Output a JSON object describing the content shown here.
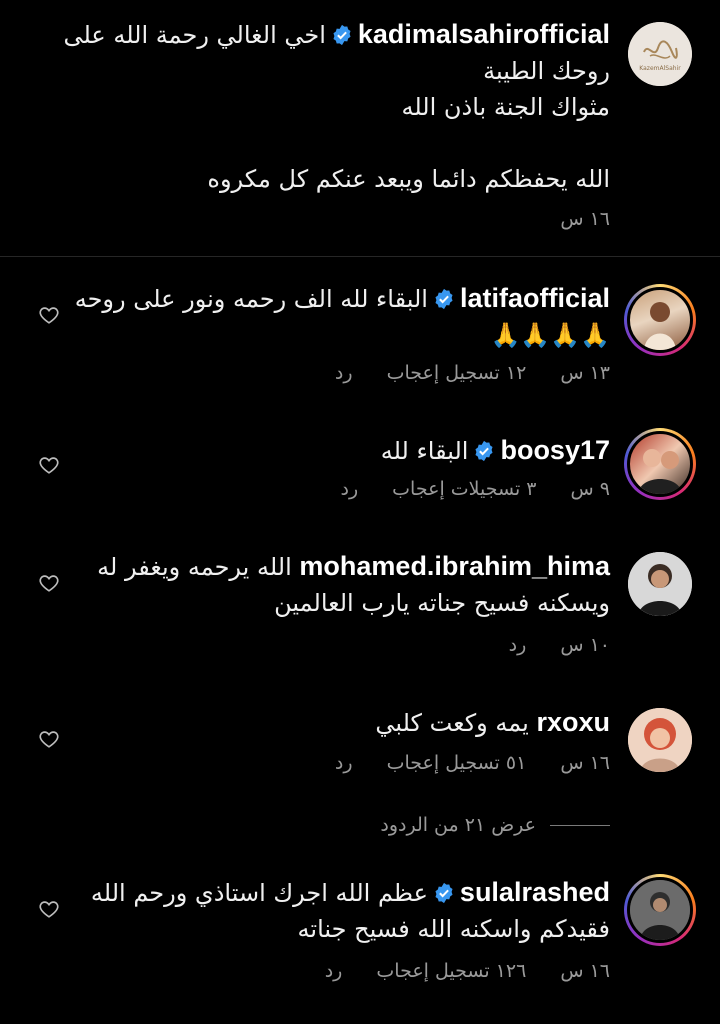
{
  "comments": [
    {
      "username": "kadimalsahirofficial",
      "verified": true,
      "avatar": "kadim-logo",
      "lines": [
        "اخي الغالي رحمة الله على",
        "روحك الطيبة",
        "مثواك الجنة باذن الله",
        "",
        "الله يحفظكم دائما ويبعد عنكم كل مكروه"
      ],
      "time": "١٦ س",
      "likes": "",
      "reply": ""
    },
    {
      "username": "latifaofficial",
      "verified": true,
      "avatar": "latifa-photo",
      "lines": [
        "البقاء لله الف رحمه ونور على روحه",
        "🙏🙏🙏🙏"
      ],
      "time": "١٣ س",
      "likes": "١٢ تسجيل إعجاب",
      "reply": "رد"
    },
    {
      "username": "boosy17",
      "verified": true,
      "avatar": "boosy-photo",
      "lines": [
        "البقاء لله"
      ],
      "time": "٩ س",
      "likes": "٣ تسجيلات إعجاب",
      "reply": "رد"
    },
    {
      "username": "mohamed.ibrahim_hima",
      "verified": false,
      "avatar": "mohamed-photo",
      "lines": [
        "الله يرحمه ويغفر له",
        "ويسكنه فسيح جناته يارب العالمين"
      ],
      "time": "١٠ س",
      "likes": "",
      "reply": "رد"
    },
    {
      "username": "rxoxu",
      "verified": false,
      "avatar": "rxoxu-photo",
      "lines": [
        "يمه وكعت كلبي"
      ],
      "time": "١٦ س",
      "likes": "٥١ تسجيل إعجاب",
      "reply": "رد"
    },
    {
      "username": "sulalrashed",
      "verified": true,
      "avatar": "sulal-photo",
      "lines": [
        "عظم الله اجرك استاذي ورحم الله",
        "فقيدكم واسكنه الله فسيح جناته"
      ],
      "time": "١٦ س",
      "likes": "١٢٦ تسجيل إعجاب",
      "reply": "رد"
    }
  ],
  "view_replies": "عرض ٢١ من الردود",
  "kadim_logo_text": "KazemAlSahir",
  "colors": {
    "background": "#000000",
    "verified": "#3897f0",
    "meta": "#9a9a9a"
  },
  "icons": {
    "like": "heart-outline-icon",
    "verified": "verified-badge-icon"
  }
}
